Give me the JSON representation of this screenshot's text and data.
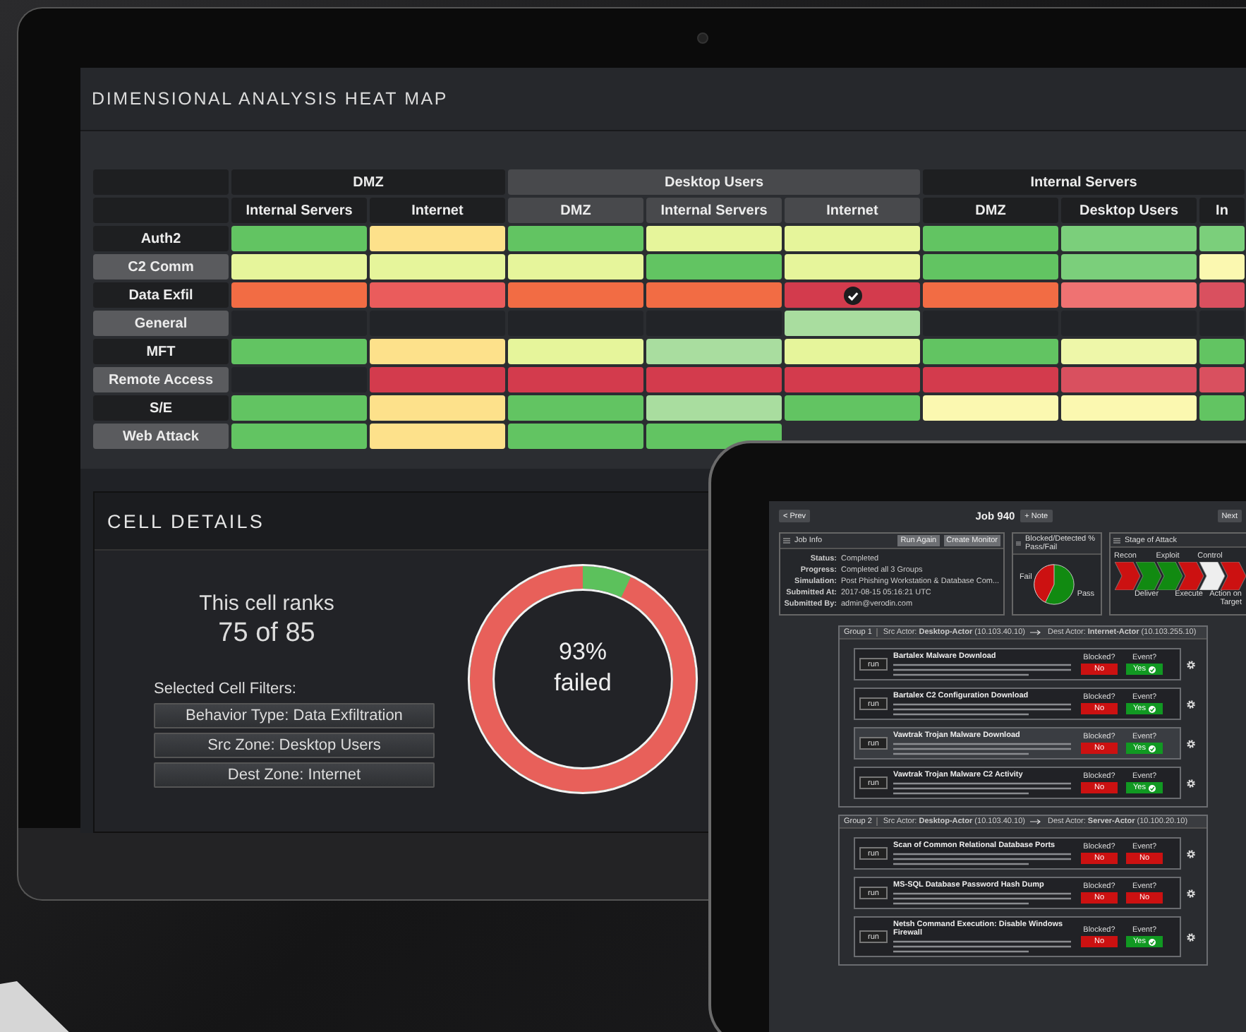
{
  "monitor": {
    "title": "DIMENSIONAL ANALYSIS HEAT MAP",
    "heat_map": {
      "groups": [
        {
          "label": "DMZ",
          "selected": false,
          "columns": [
            "Internal Servers",
            "Internet"
          ]
        },
        {
          "label": "Desktop Users",
          "selected": true,
          "columns": [
            "DMZ",
            "Internal Servers",
            "Internet"
          ]
        },
        {
          "label": "Internal Servers",
          "selected": false,
          "columns": [
            "DMZ",
            "Desktop Users",
            "In"
          ]
        }
      ],
      "rows": [
        {
          "label": "Auth2",
          "cells": [
            {
              "color": "#62c462",
              "selected": false
            },
            {
              "color": "#fde18b",
              "selected": false
            },
            {
              "color": "#62c462",
              "selected": false
            },
            {
              "color": "#e6f59b",
              "selected": false
            },
            {
              "color": "#e6f59b",
              "selected": false
            },
            {
              "color": "#62c462",
              "selected": false
            },
            {
              "color": "#7bcf7b",
              "selected": false
            },
            {
              "color": "#7bcf7b",
              "selected": false
            }
          ]
        },
        {
          "label": "C2 Comm",
          "cells": [
            {
              "color": "#e6f59b",
              "selected": false
            },
            {
              "color": "#e6f59b",
              "selected": false
            },
            {
              "color": "#e6f59b",
              "selected": false
            },
            {
              "color": "#62c462",
              "selected": false
            },
            {
              "color": "#e6f59b",
              "selected": false
            },
            {
              "color": "#62c462",
              "selected": false
            },
            {
              "color": "#7bcf7b",
              "selected": false
            },
            {
              "color": "#fbf8b0",
              "selected": false
            }
          ]
        },
        {
          "label": "Data Exfil",
          "cells": [
            {
              "color": "#f26c44",
              "selected": false
            },
            {
              "color": "#ea5c5c",
              "selected": false
            },
            {
              "color": "#f26c44",
              "selected": false
            },
            {
              "color": "#f26c44",
              "selected": false
            },
            {
              "color": "#d33b4d",
              "selected": true
            },
            {
              "color": "#f26c44",
              "selected": false
            },
            {
              "color": "#ef7272",
              "selected": false
            },
            {
              "color": "#d9505f",
              "selected": false
            }
          ]
        },
        {
          "label": "General",
          "cells": [
            {
              "selected": false
            },
            {
              "selected": false
            },
            {
              "selected": false
            },
            {
              "selected": false
            },
            {
              "color": "#a9dd9f",
              "selected": false
            },
            {
              "selected": false
            },
            {
              "selected": false
            },
            {
              "selected": false
            }
          ]
        },
        {
          "label": "MFT",
          "cells": [
            {
              "color": "#62c462",
              "selected": false
            },
            {
              "color": "#fde18b",
              "selected": false
            },
            {
              "color": "#e6f59b",
              "selected": false
            },
            {
              "color": "#a9dd9f",
              "selected": false
            },
            {
              "color": "#e6f59b",
              "selected": false
            },
            {
              "color": "#62c462",
              "selected": false
            },
            {
              "color": "#eef7a9",
              "selected": false
            },
            {
              "color": "#62c462",
              "selected": false
            }
          ]
        },
        {
          "label": "Remote Access",
          "cells": [
            {
              "selected": false
            },
            {
              "color": "#d33b4d",
              "selected": false
            },
            {
              "color": "#d33b4d",
              "selected": false
            },
            {
              "color": "#d33b4d",
              "selected": false
            },
            {
              "color": "#d33b4d",
              "selected": false
            },
            {
              "color": "#d33b4d",
              "selected": false
            },
            {
              "color": "#d9505f",
              "selected": false
            },
            {
              "color": "#d9505f",
              "selected": false
            }
          ]
        },
        {
          "label": "S/E",
          "cells": [
            {
              "color": "#62c462",
              "selected": false
            },
            {
              "color": "#fde18b",
              "selected": false
            },
            {
              "color": "#62c462",
              "selected": false
            },
            {
              "color": "#a9dd9f",
              "selected": false
            },
            {
              "color": "#62c462",
              "selected": false
            },
            {
              "color": "#fbf8b0",
              "selected": false
            },
            {
              "color": "#fbf8b0",
              "selected": false
            },
            {
              "color": "#62c462",
              "selected": false
            }
          ]
        },
        {
          "label": "Web Attack",
          "cells": [
            {
              "color": "#62c462",
              "selected": false
            },
            {
              "color": "#fde18b",
              "selected": false
            },
            {
              "color": "#62c462",
              "selected": false
            },
            {
              "color": "#62c462",
              "selected": false
            }
          ]
        }
      ]
    },
    "cell_details": {
      "title": "CELL DETAILS",
      "rank_caption": "This cell ranks",
      "rank": "75 of 85",
      "filters_label": "Selected Cell Filters:",
      "filters": [
        "Behavior Type: Data Exfiltration",
        "Src Zone: Desktop Users",
        "Dest Zone: Internet"
      ],
      "ring": {
        "level": 0.93,
        "value": "93%",
        "caption": "failed"
      }
    }
  },
  "tablet": {
    "nav": {
      "prev": "< Prev",
      "title": "Job 940",
      "note": "+ Note",
      "next": "Next"
    },
    "job_info": {
      "title": "Job Info",
      "buttons": [
        "Run Again",
        "Create Monitor"
      ],
      "fields": [
        {
          "label": "Status:",
          "value": "Completed"
        },
        {
          "label": "Progress:",
          "value": "Completed all 3 Groups"
        },
        {
          "label": "Simulation:",
          "value": "Post Phishing Workstation & Database Com..."
        },
        {
          "label": "Submitted At:",
          "value": "2017-08-15 05:16:21 UTC"
        },
        {
          "label": "Submitted By:",
          "value": "admin@verodin.com"
        }
      ]
    },
    "pass_fail": {
      "title": "Blocked/Detected % Pass/Fail",
      "labels": [
        "Fail",
        "Pass"
      ]
    },
    "stages": {
      "title": "Stage of Attack",
      "steps": [
        {
          "label": "Recon",
          "color": "#cc1111"
        },
        {
          "label": "Deliver",
          "color": "#118a11"
        },
        {
          "label": "Exploit",
          "color": "#118a11"
        },
        {
          "label": "Execute",
          "color": "#cc1111"
        },
        {
          "label": "Control",
          "color": "#eeeeee"
        },
        {
          "label": "Action on Target",
          "color": "#cc1111"
        }
      ]
    },
    "groups": [
      {
        "label": "Group 1",
        "src": "Src Actor: **Desktop-Actor** (10.103.40.10)",
        "dest": "Dest Actor: **Internet-Actor** (10.103.255.10)",
        "actions": [
          {
            "button": "run",
            "title": "Bartalex Malware Download",
            "selected": false,
            "blocked": {
              "label": "Blocked?",
              "value": "No",
              "on": false
            },
            "event": {
              "label": "Event?",
              "value": "Yes",
              "on": true
            }
          },
          {
            "button": "run",
            "title": "Bartalex C2 Configuration Download",
            "selected": false,
            "blocked": {
              "label": "Blocked?",
              "value": "No",
              "on": false
            },
            "event": {
              "label": "Event?",
              "value": "Yes",
              "on": true
            }
          },
          {
            "button": "run",
            "title": "Vawtrak Trojan Malware Download",
            "selected": true,
            "blocked": {
              "label": "Blocked?",
              "value": "No",
              "on": false
            },
            "event": {
              "label": "Event?",
              "value": "Yes",
              "on": true
            }
          },
          {
            "button": "run",
            "title": "Vawtrak Trojan Malware C2 Activity",
            "selected": false,
            "blocked": {
              "label": "Blocked?",
              "value": "No",
              "on": false
            },
            "event": {
              "label": "Event?",
              "value": "Yes",
              "on": true
            }
          }
        ]
      },
      {
        "label": "Group 2",
        "src": "Src Actor: **Desktop-Actor** (10.103.40.10)",
        "dest": "Dest Actor: **Server-Actor** (10.100.20.10)",
        "actions": [
          {
            "button": "run",
            "title": "Scan of Common Relational Database Ports",
            "selected": false,
            "blocked": {
              "label": "Blocked?",
              "value": "No",
              "on": false
            },
            "event": {
              "label": "Event?",
              "value": "No",
              "on": false
            }
          },
          {
            "button": "run",
            "title": "MS-SQL Database Password Hash Dump",
            "selected": false,
            "blocked": {
              "label": "Blocked?",
              "value": "No",
              "on": false
            },
            "event": {
              "label": "Event?",
              "value": "No",
              "on": false
            }
          },
          {
            "button": "run",
            "title": "Netsh Command Execution: Disable Windows Firewall",
            "selected": false,
            "blocked": {
              "label": "Blocked?",
              "value": "No",
              "on": false
            },
            "event": {
              "label": "Event?",
              "value": "Yes",
              "on": true
            }
          }
        ]
      }
    ]
  }
}
